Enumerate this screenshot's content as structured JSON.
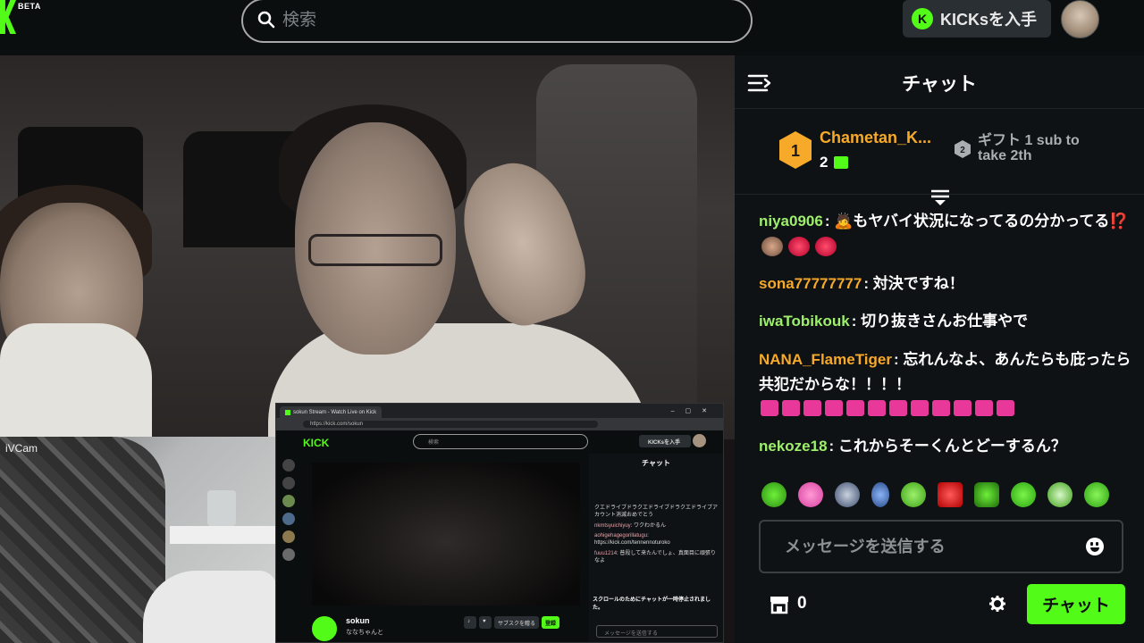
{
  "brand": {
    "beta_label": "BETA",
    "accent": "#53fc18"
  },
  "search": {
    "placeholder": "検索"
  },
  "header": {
    "kicks_label": "KICKsを入手",
    "kicks_coin": "K"
  },
  "camera": {
    "watermark": "iVCam"
  },
  "mini_browser": {
    "tab_title": "sokun Stream - Watch Live on Kick",
    "url": "https://kick.com/sokun",
    "logo": "KICK",
    "search_placeholder": "検索",
    "kicks_label": "KICKsを入手",
    "chat_title": "チャット",
    "streamer_name": "sokun",
    "streamer_sub": "ななちゃんと",
    "subscribe_label": "サブスクを贈る",
    "follow_label": "登録",
    "messages": [
      {
        "user": "",
        "text": "クエドライブドラクエドライブドラクエドライブアカウント消滅おめでとう"
      },
      {
        "user": "nkmtsyuichiyuy",
        "text": ": ワクわかるん"
      },
      {
        "user": "aohigehagegorillatugu",
        "text": ": https://kick.com/tennennoturoko"
      },
      {
        "user": "fuuu1214",
        "text": ": 普段して来たんでしょ、真面目に頑張りなよ"
      }
    ],
    "notice": "スクロールのためにチャットが一時停止されました。",
    "input_placeholder": "メッセージを送信する"
  },
  "chat": {
    "title": "チャット",
    "leaderboard": {
      "first": {
        "rank": "1",
        "name": "Chametan_K...",
        "count": "2"
      },
      "second": {
        "rank": "2",
        "text": "ギフト 1 sub to take 2th"
      }
    },
    "messages": [
      {
        "user": "niya0906",
        "color": "#9ef06c",
        "text": ": 🙇もヤバイ状況になってるの分かってる⁉️"
      },
      {
        "user": "sona77777777",
        "color": "#f7a929",
        "text": ": 対決ですね！"
      },
      {
        "user": "iwaTobikouk",
        "color": "#9ef06c",
        "text": ": 切り抜きさんお仕事やで"
      },
      {
        "user": "NANA_FlameTiger",
        "color": "#f7a929",
        "text": ": 忘れんなよ、あんたらも庇ったら共犯だからな！！！！"
      },
      {
        "user": "nekoze18",
        "color": "#9ef06c",
        "text": ": これからそーくんとどーするん？"
      }
    ],
    "input_placeholder": "メッセージを送信する",
    "points": "0",
    "send_label": "チャット"
  }
}
